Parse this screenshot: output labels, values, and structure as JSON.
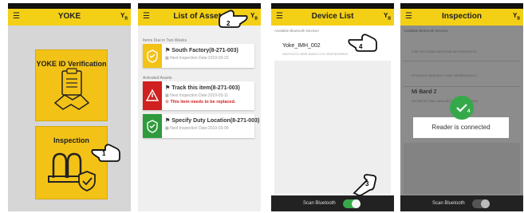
{
  "colors": {
    "accent": "#f3d016",
    "card": "#f3c217",
    "alert": "#d02020",
    "ok": "#2f9b3c",
    "toggle": "#35a94a"
  },
  "screen1": {
    "title": "YOKE",
    "menu_icon": "menu-icon",
    "corner_icon": "bluetooth-logo-icon",
    "corner_text": "Yₑ",
    "verification_label": "YOKE ID Verification",
    "inspection_label": "Inspection",
    "step": "1"
  },
  "screen2": {
    "title": "List of Assets",
    "step": "2",
    "section_due": "Items Due in Two Weeks",
    "section_activated": "Activated Assets",
    "items": [
      {
        "name": "South Factory(8-271-003)",
        "next": "Next Inspection Date:2019-03-23",
        "warning": "",
        "status": "pending"
      },
      {
        "name": "Track this item(8-271-003)",
        "next": "Next Inspection Date:2019-03-11",
        "warning": "This item needs to be replaced.",
        "status": "alert"
      },
      {
        "name": "Specify Duty Location(8-271-003)",
        "next": "Next Inspection Date:2019-03-09",
        "warning": "",
        "status": "ok"
      }
    ]
  },
  "screen3": {
    "title": "Device List",
    "list_header": "Available Bluetooth Devices",
    "device_name": "Yoke_IMH_002",
    "device_id": "DB2F4DCD-8636-BA5A-0710-3EAFBDB0B34",
    "steps": [
      "4",
      "3"
    ],
    "scan_label": "Scan Bluetooth",
    "scan_on": true
  },
  "screen4": {
    "title": "Inspection",
    "list_header": "Available Bluetooth Devices",
    "devices": [
      {
        "name": "",
        "id": "F38F7A53-838A-4853-B338-A4C4B55D8CF4"
      },
      {
        "name": "",
        "id": "EF4483CE-2B4B-6D27-B557-9F8BB030A61C"
      },
      {
        "name": "Mi Band 2",
        "id": "9DC3B78F-E264-459A-BE71-A8A6DB8800E6"
      }
    ],
    "message": "Reader is connected",
    "step": "4",
    "scan_label": "Scan Bluetooth",
    "scan_on": false
  }
}
